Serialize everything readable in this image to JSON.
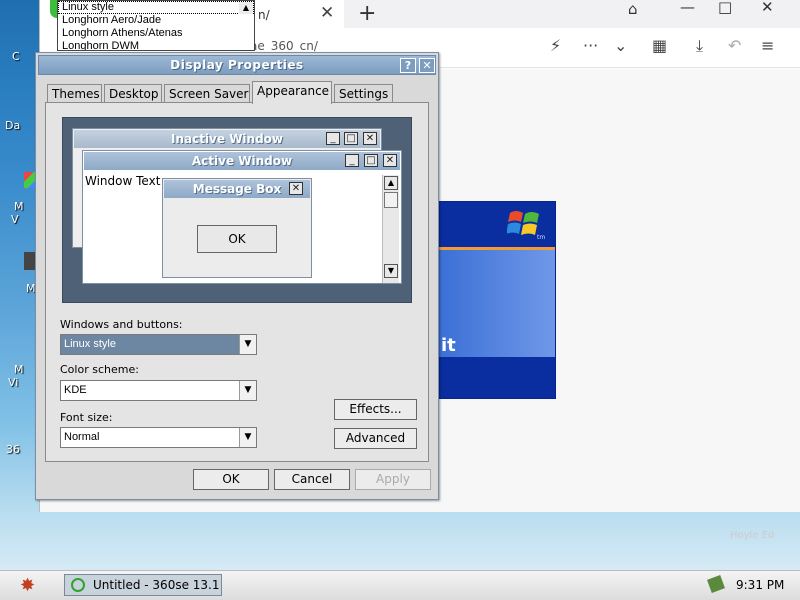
{
  "desktop": {
    "labels": [
      "C",
      "Da",
      "M",
      "V",
      "M",
      "M",
      "Vi",
      "36"
    ]
  },
  "browser": {
    "tab_title": "n/",
    "url": "ae_360_cn/",
    "xp_text": "it",
    "xp_tm": "tm",
    "watermark": "Hoyle Ed"
  },
  "dropdown_list": {
    "options": [
      "Linux style",
      "Longhorn Aero/Jade",
      "Longhorn Athens/Atenas",
      "Longhorn DWM"
    ]
  },
  "dialog": {
    "title": "Display Properties",
    "help": "?",
    "close": "✕",
    "tabs": [
      "Themes",
      "Desktop",
      "Screen Saver",
      "Appearance",
      "Settings"
    ],
    "active_tab": "Appearance",
    "preview": {
      "inactive_title": "Inactive Window",
      "active_title": "Active Window",
      "window_text": "Window Text",
      "message_title": "Message Box",
      "ok": "OK"
    },
    "windows_buttons_label": "Windows and buttons:",
    "windows_buttons_value": "Linux style",
    "color_scheme_label": "Color scheme:",
    "color_scheme_value": "KDE",
    "font_size_label": "Font size:",
    "font_size_value": "Normal",
    "effects": "Effects...",
    "advanced": "Advanced",
    "ok": "OK",
    "cancel": "Cancel",
    "apply": "Apply"
  },
  "taskbar": {
    "task_label": "Untitled - 360se 13.1",
    "clock": "9:31 PM"
  }
}
